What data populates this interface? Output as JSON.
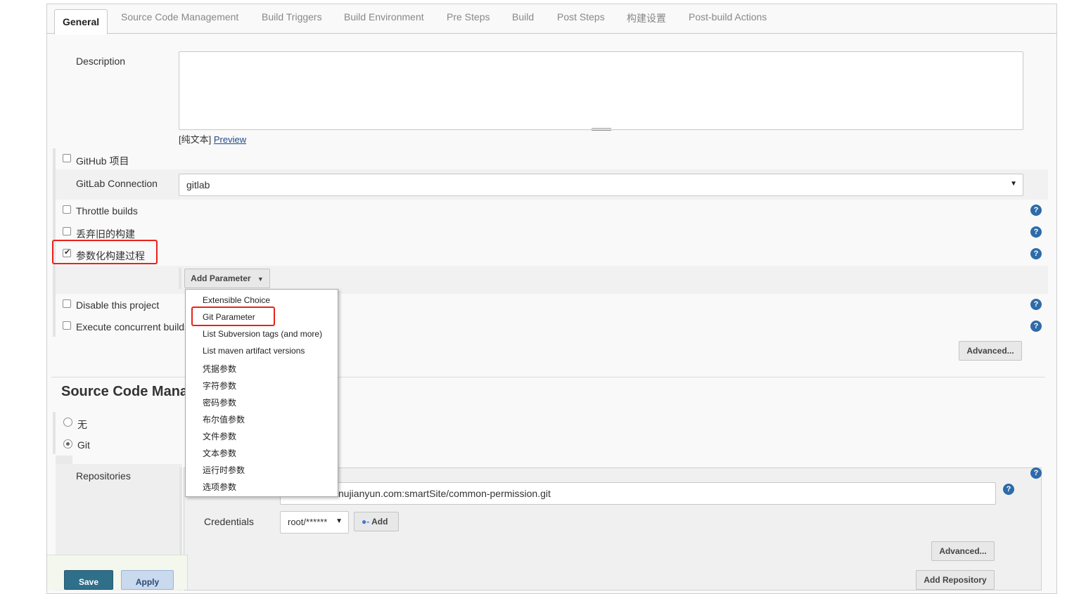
{
  "tabs": [
    "General",
    "Source Code Management",
    "Build Triggers",
    "Build Environment",
    "Pre Steps",
    "Build",
    "Post Steps",
    "构建设置",
    "Post-build Actions"
  ],
  "general": {
    "description_label": "Description",
    "description_value": "",
    "plain_text": "[纯文本]",
    "preview": "Preview",
    "github_project": "GitHub 项目",
    "gitlab_connection_label": "GitLab Connection",
    "gitlab_connection_value": "gitlab",
    "throttle_builds": "Throttle builds",
    "discard_old_builds": "丢弃旧的构建",
    "parameterized": "参数化构建过程",
    "add_parameter": "Add Parameter",
    "disable_project": "Disable this project",
    "execute_concurrent": "Execute concurrent builds if necessary",
    "advanced": "Advanced..."
  },
  "parameter_menu": {
    "items": [
      "Extensible Choice",
      "Git Parameter",
      "List Subversion tags (and more)",
      "List maven artifact versions",
      "凭据参数",
      "字符参数",
      "密码参数",
      "布尔值参数",
      "文件参数",
      "文本参数",
      "运行时参数",
      "选项参数"
    ],
    "highlighted": "Git Parameter"
  },
  "scm": {
    "title": "Source Code Management",
    "option_none": "无",
    "option_git": "Git",
    "repositories_label": "Repositories",
    "repository_url_visible": "nujianyun.com:smartSite/common-permission.git",
    "credentials_label": "Credentials",
    "credentials_value": "root/******",
    "add_label": "Add",
    "advanced": "Advanced...",
    "add_repository": "Add Repository"
  },
  "footer": {
    "save": "Save",
    "apply": "Apply"
  },
  "help_glyph": "?",
  "colors": {
    "highlight_red": "#e8231a",
    "help_blue": "#2e6ba8",
    "save_button": "#2f6f8a",
    "link_blue": "#204a87"
  }
}
